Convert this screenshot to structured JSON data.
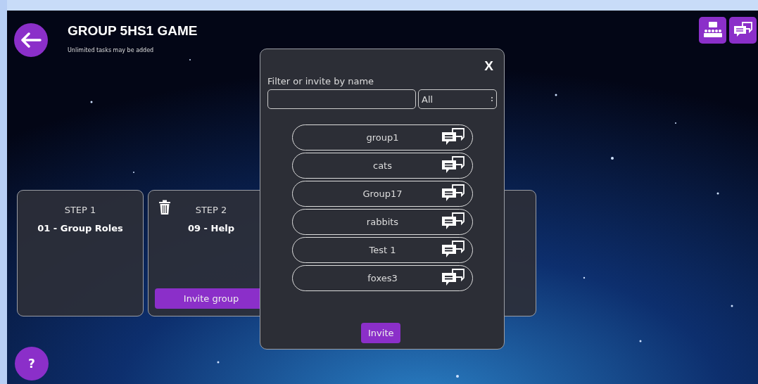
{
  "header": {
    "title": "GROUP 5HS1 GAME",
    "subtitle": "Unlimited tasks may be added"
  },
  "steps": [
    {
      "kind": "task",
      "label": "STEP 1",
      "task": "01 - Group Roles",
      "deletable": false
    },
    {
      "kind": "task",
      "label": "STEP 2",
      "task": "09 - Help",
      "deletable": true,
      "button": "Invite group"
    },
    {
      "kind": "covered"
    }
  ],
  "help": "?",
  "dialog": {
    "close": "X",
    "filter_label": "Filter or invite by name",
    "scope": "All",
    "groups": [
      {
        "name": "group1"
      },
      {
        "name": "cats"
      },
      {
        "name": "Group17"
      },
      {
        "name": "rabbits"
      },
      {
        "name": "Test 1"
      },
      {
        "name": "foxes3"
      }
    ],
    "invite_button": "Invite"
  }
}
